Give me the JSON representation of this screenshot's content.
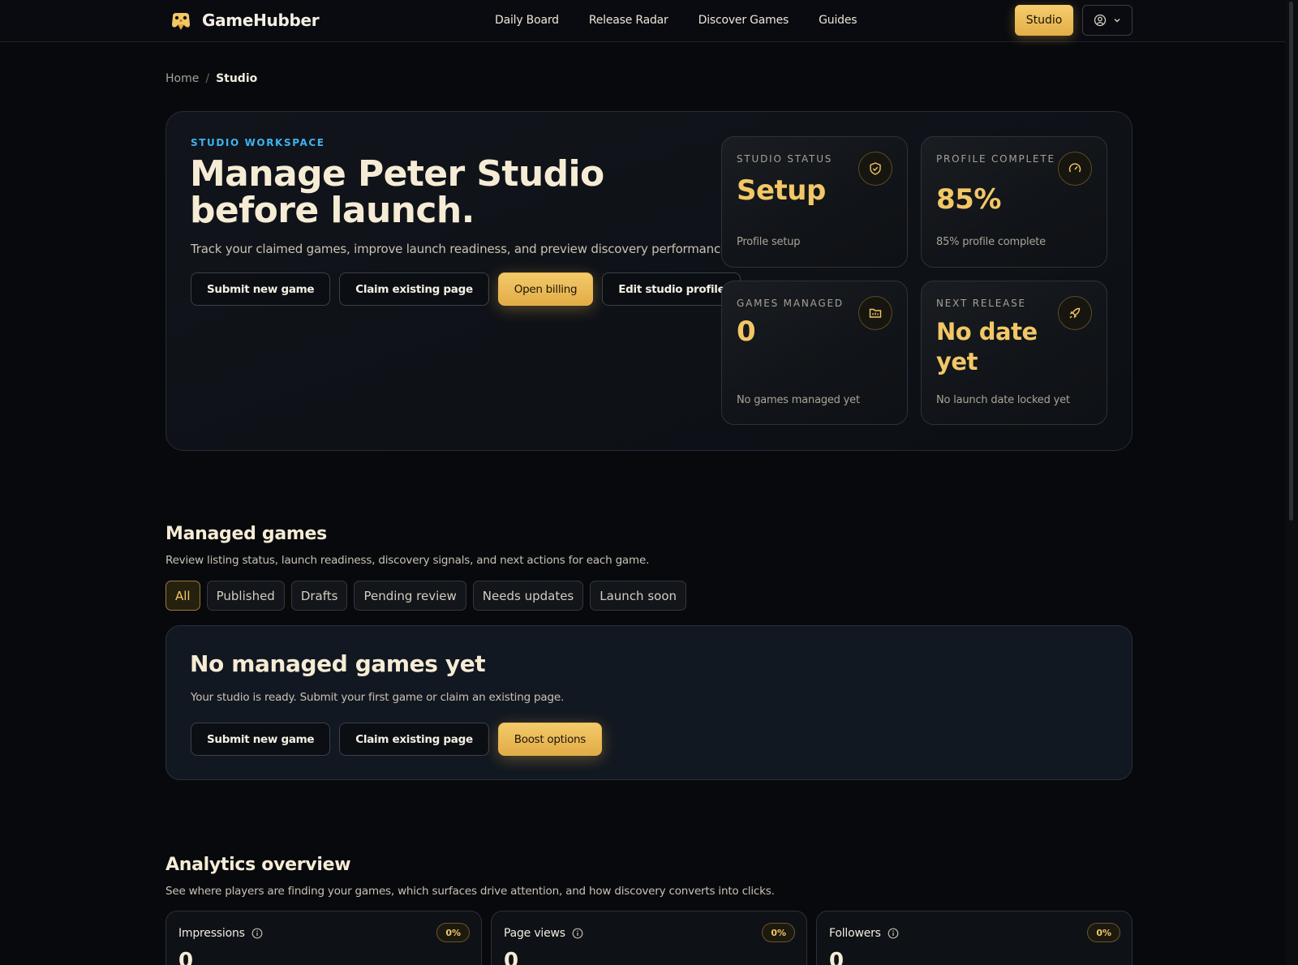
{
  "nav": {
    "brand": "GameHubber",
    "links": [
      "Daily Board",
      "Release Radar",
      "Discover Games",
      "Guides"
    ],
    "studio_label": "Studio"
  },
  "breadcrumb": {
    "home": "Home",
    "separator": "/",
    "current": "Studio"
  },
  "hero": {
    "eyebrow": "STUDIO WORKSPACE",
    "title": "Manage Peter Studio before launch.",
    "subtitle": "Track your claimed games, improve launch readiness, and preview discovery performance.",
    "buttons": [
      "Submit new game",
      "Claim existing page",
      "Open billing",
      "Edit studio profile"
    ],
    "stats": [
      {
        "label": "STUDIO STATUS",
        "value": "Setup",
        "note": "Profile setup",
        "icon": "shield-check-icon"
      },
      {
        "label": "PROFILE COMPLETE",
        "value": "85%",
        "note": "85% profile complete",
        "icon": "gauge-icon"
      },
      {
        "label": "GAMES MANAGED",
        "value": "0",
        "note": "No games managed yet",
        "icon": "folder-icon"
      },
      {
        "label": "NEXT RELEASE",
        "value": "No date yet",
        "note": "No launch date locked yet",
        "icon": "rocket-icon"
      }
    ]
  },
  "managed": {
    "title": "Managed games",
    "subtitle": "Review listing status, launch readiness, discovery signals, and next actions for each game.",
    "filters": [
      "All",
      "Published",
      "Drafts",
      "Pending review",
      "Needs updates",
      "Launch soon"
    ],
    "active_filter": "All",
    "empty": {
      "title": "No managed games yet",
      "subtitle": "Your studio is ready. Submit your first game or claim an existing page.",
      "buttons": [
        "Submit new game",
        "Claim existing page",
        "Boost options"
      ]
    }
  },
  "analytics": {
    "title": "Analytics overview",
    "subtitle": "See where players are finding your games, which surfaces drive attention, and how discovery converts into clicks.",
    "cards": [
      {
        "label": "Impressions",
        "badge": "0%",
        "value": "0"
      },
      {
        "label": "Page views",
        "badge": "0%",
        "value": "0"
      },
      {
        "label": "Followers",
        "badge": "0%",
        "value": "0"
      }
    ]
  },
  "colors": {
    "accent": "#f2c766",
    "eyebrow": "#3eb3f0",
    "background": "#07090d"
  }
}
